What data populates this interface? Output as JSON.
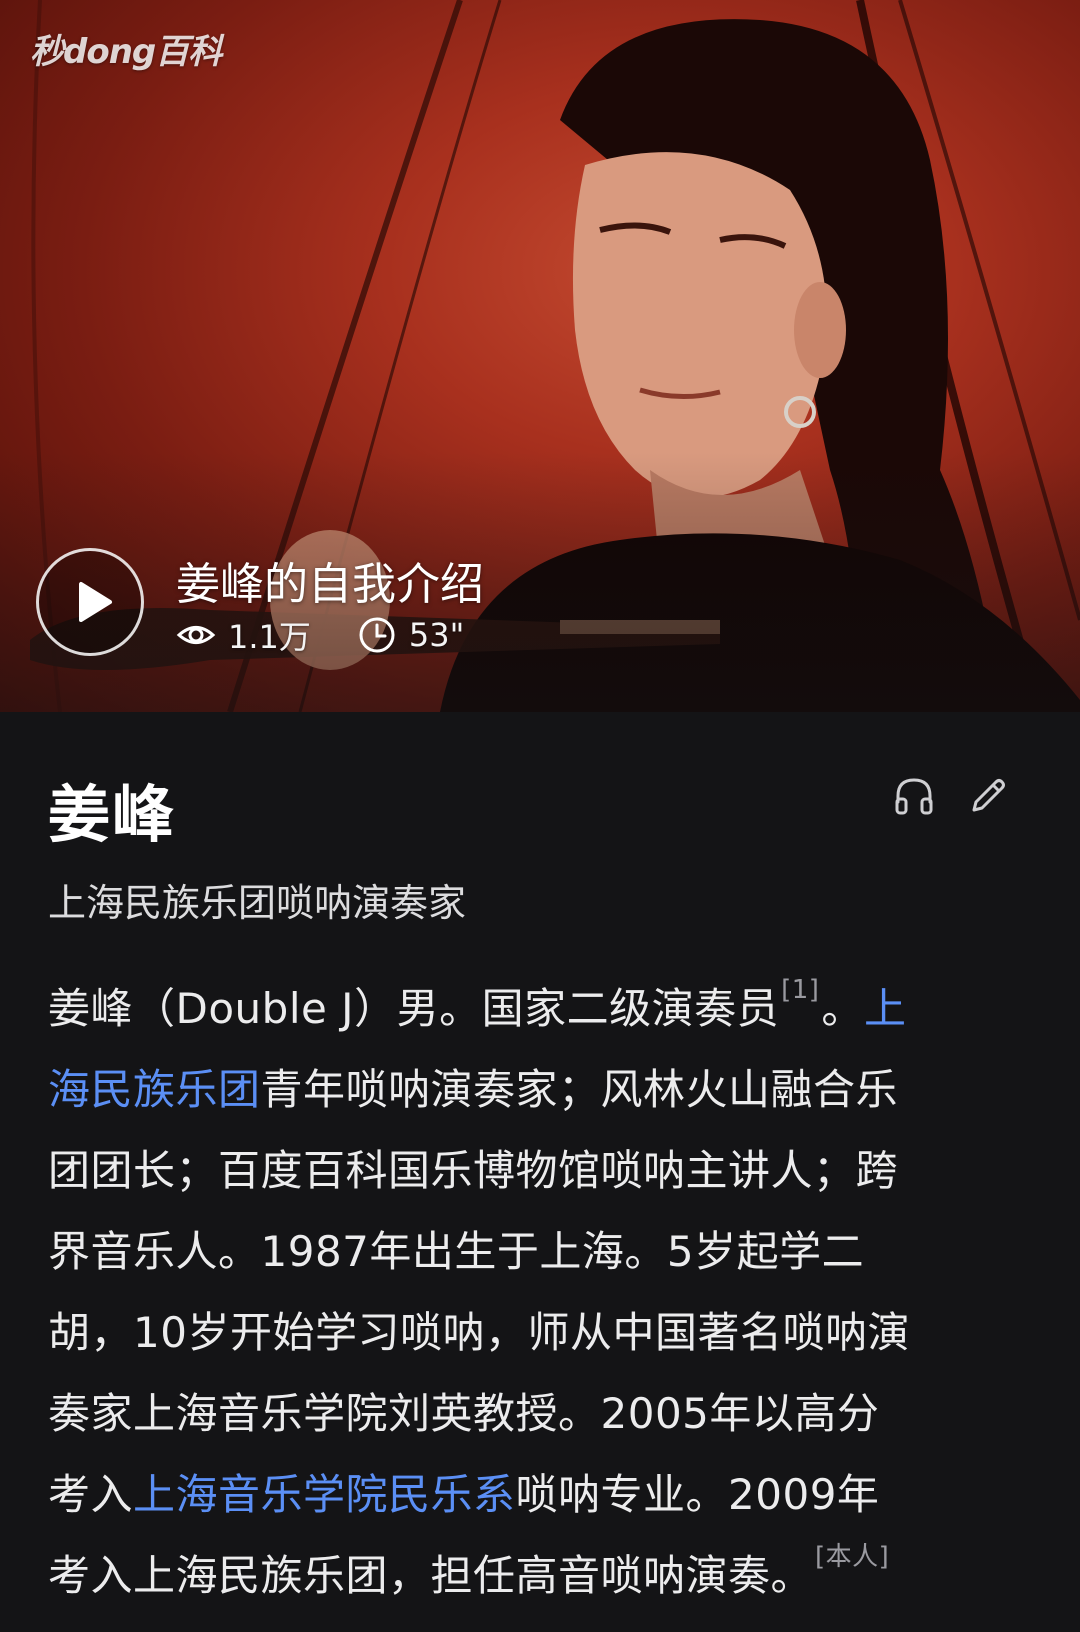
{
  "video": {
    "watermark": "秒dong百科",
    "title": "姜峰的自我介绍",
    "views": "1.1万",
    "duration": "53\""
  },
  "entry": {
    "title": "姜峰",
    "subtitle": "上海民族乐团唢呐演奏家"
  },
  "summary": {
    "l1_a": "姜峰（Double J）男。国家二级演奏员",
    "l1_ref": "[1]",
    "l1_b": "。",
    "l1_link": "上",
    "l2_link": "海民族乐团",
    "l2_b": "青年唢呐演奏家；风林火山融合乐",
    "l3": "团团长；百度百科国乐博物馆唢呐主讲人；跨",
    "l4": "界音乐人。1987年出生于上海。5岁起学二",
    "l5": "胡，10岁开始学习唢呐，师从中国著名唢呐演",
    "l6": "奏家上海音乐学院刘英教授。2005年以高分",
    "l7_a": "考入",
    "l7_link": "上海音乐学院民乐系",
    "l7_b": "唢呐专业。2009年",
    "l8": "考入上海民族乐团，担任高音唢呐演奏。",
    "l8_ref": "[本人]"
  },
  "icons": {
    "listen": "headphones-icon",
    "edit": "pencil-icon",
    "views": "eye-icon",
    "duration": "clock-icon",
    "play": "play-icon"
  },
  "colors": {
    "background": "#141416",
    "link": "#5b8ff5",
    "hero_red": "#a8301e"
  }
}
